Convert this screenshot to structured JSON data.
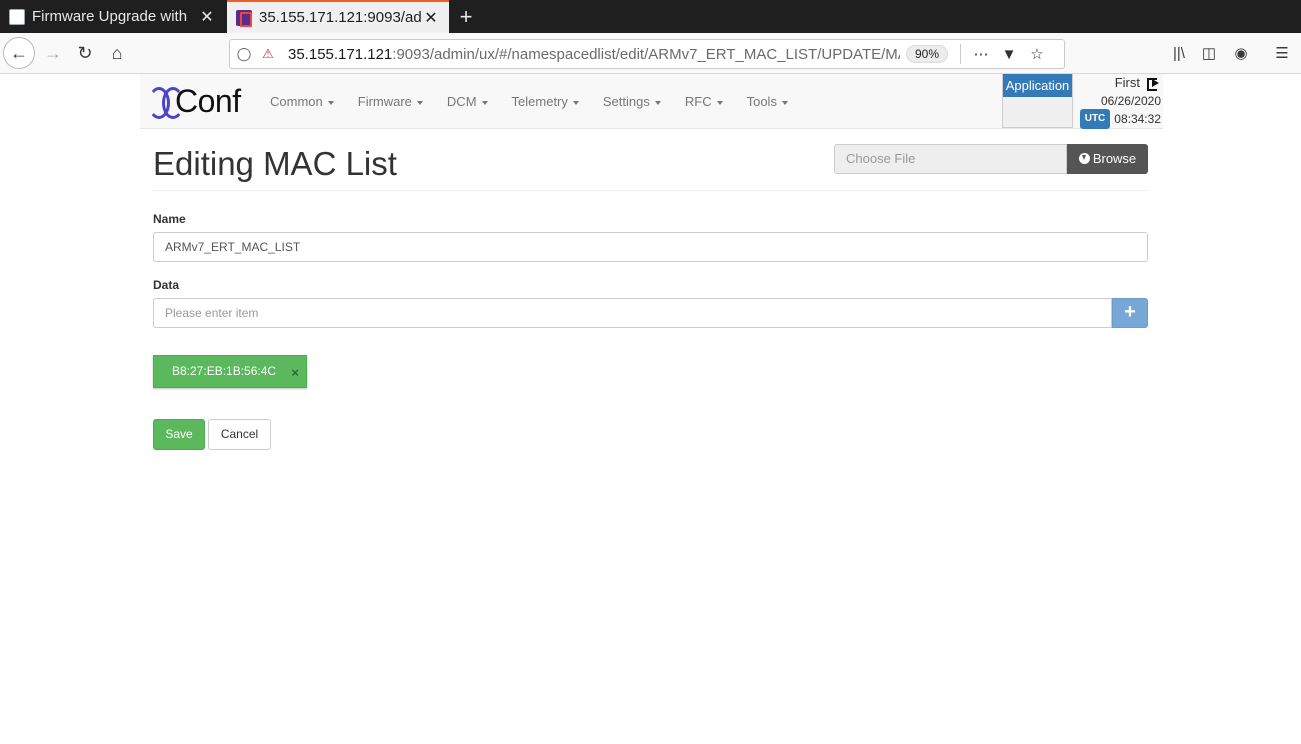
{
  "browser": {
    "tabs": [
      {
        "title": "Firmware Upgrade with",
        "close": "✕"
      },
      {
        "title": "35.155.171.121:9093/ad",
        "close": "✕"
      }
    ],
    "new_tab": "+",
    "url_host": "35.155.171.121",
    "url_rest": ":9093/admin/ux/#/namespacedlist/edit/ARMv7_ERT_MAC_LIST/UPDATE/MA",
    "zoom": "90%"
  },
  "header": {
    "logo_text": "Conf",
    "menu": [
      {
        "label": "Common"
      },
      {
        "label": "Firmware"
      },
      {
        "label": "DCM"
      },
      {
        "label": "Telemetry"
      },
      {
        "label": "Settings"
      },
      {
        "label": "RFC"
      },
      {
        "label": "Tools"
      }
    ],
    "application_label": "Application",
    "user_name": "First",
    "date": "06/26/2020",
    "tz_badge": "UTC",
    "time": "08:34:32"
  },
  "page": {
    "title": "Editing MAC List",
    "file_placeholder": "Choose File",
    "browse_label": "Browse",
    "name_label": "Name",
    "name_value": "ARMv7_ERT_MAC_LIST",
    "data_label": "Data",
    "data_placeholder": "Please enter item",
    "add_symbol": "+",
    "items": [
      {
        "mac": "B8:27:EB:1B:56:4C",
        "remove": "×"
      }
    ],
    "save_label": "Save",
    "cancel_label": "Cancel"
  },
  "colors": {
    "primary": "#337ab7",
    "success": "#5cb85c",
    "logo_accent": "#4b44c9"
  }
}
